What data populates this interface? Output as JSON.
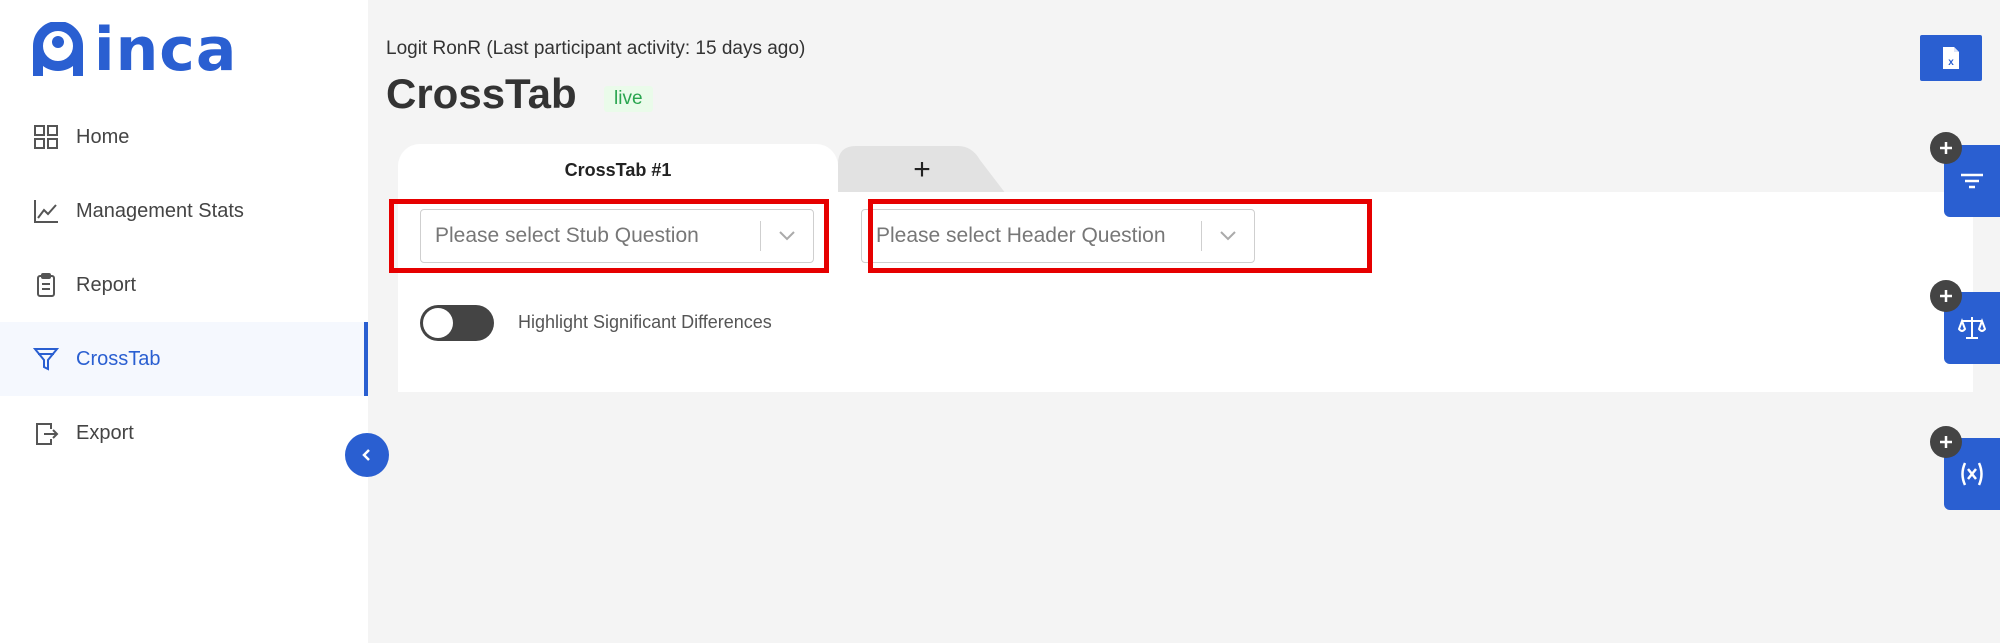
{
  "brand": {
    "name": "inca",
    "color": "#2a5fd1"
  },
  "sidebar": {
    "items": [
      {
        "label": "Home",
        "icon": "grid-icon",
        "active": false
      },
      {
        "label": "Management Stats",
        "icon": "line-chart-icon",
        "active": false
      },
      {
        "label": "Report",
        "icon": "clipboard-icon",
        "active": false
      },
      {
        "label": "CrossTab",
        "icon": "filter-icon",
        "active": true
      },
      {
        "label": "Export",
        "icon": "file-export-icon",
        "active": false
      }
    ],
    "collapse_icon": "chevron-left-icon"
  },
  "header": {
    "breadcrumb": "Logit RonR (Last participant activity: 15 days ago)",
    "title": "CrossTab",
    "status_badge": "live"
  },
  "toolbar": {
    "export_icon": "excel-file-icon"
  },
  "tabs": [
    {
      "label": "CrossTab #1",
      "active": true
    },
    {
      "label": "+",
      "active": false
    }
  ],
  "crosstab": {
    "stub_select": {
      "placeholder": "Please select Stub Question",
      "value": ""
    },
    "header_select": {
      "placeholder": "Please select Header Question",
      "value": ""
    },
    "highlight_toggle": {
      "label": "Highlight Significant Differences",
      "on": false
    }
  },
  "side_actions": [
    {
      "icon": "filter-lines-icon"
    },
    {
      "icon": "scale-balance-icon"
    },
    {
      "icon": "variable-x-icon"
    }
  ],
  "colors": {
    "accent": "#2a5fd1",
    "highlight_border": "#e60000",
    "live_green": "#2aa54f"
  }
}
